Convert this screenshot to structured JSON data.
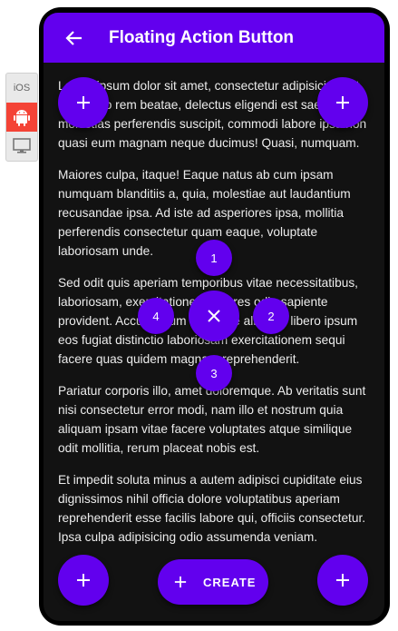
{
  "platforms": [
    {
      "name": "iOS",
      "icon": "ios-text"
    },
    {
      "name": "Android",
      "icon": "android-icon",
      "active": true
    },
    {
      "name": "Desktop",
      "icon": "monitor-icon"
    }
  ],
  "toolbar": {
    "title": "Floating Action Button",
    "back_icon": "arrow-left-icon"
  },
  "content": {
    "paragraphs": [
      "Lorem ipsum dolor sit amet, consectetur adipisicing elit. Illum, quo rem beatae, delectus eligendi est saepe molestias perferendis suscipit, commodi labore ipsa non quasi eum magnam neque ducimus! Quasi, numquam.",
      "Maiores culpa, itaque! Eaque natus ab cum ipsam numquam blanditiis a, quia, molestiae aut laudantium recusandae ipsa. Ad iste ad asperiores ipsa, mollitia perferendis consectetur quam eaque, voluptate laboriosam unde.",
      "Sed odit quis aperiam temporibus vitae necessitatibus, laboriosam, exercitationem dolores odio sapiente provident. Accusantium id, itaque aliquam libero ipsum eos fugiat distinctio laboriosam exercitationem sequi facere quas quidem magnam reprehenderit.",
      "Pariatur corporis illo, amet doloremque. Ab veritatis sunt nisi consectetur error modi, nam illo et nostrum quia aliquam ipsam vitae facere voluptates atque similique odit mollitia, rerum placeat nobis est.",
      "Et impedit soluta minus a autem adipisci cupiditate eius dignissimos nihil officia dolore voluptatibus aperiam reprehenderit esse facilis labore qui, officiis consectetur. Ipsa culpa adipisicing odio assumenda veniam."
    ]
  },
  "fabs": {
    "top_left_icon": "plus-icon",
    "top_right_icon": "plus-icon",
    "bottom_left_icon": "plus-icon",
    "bottom_right_icon": "plus-icon",
    "center_icon": "close-icon",
    "list_items": [
      "1",
      "2",
      "3",
      "4"
    ]
  },
  "extended_fab": {
    "label": "CREATE",
    "icon": "plus-icon"
  },
  "colors": {
    "primary": "#6200ee",
    "background": "#121212",
    "text": "#ececec",
    "android_active": "#f44336"
  }
}
